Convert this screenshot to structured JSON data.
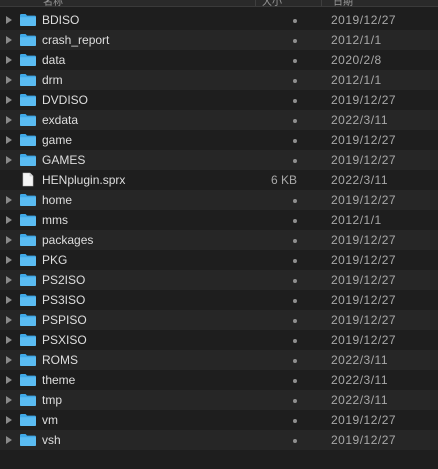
{
  "header": {
    "name": "名称",
    "size": "大小",
    "date": "日期"
  },
  "rows": [
    {
      "name": "BDISO",
      "type": "folder",
      "size": "",
      "date": "2019/12/27"
    },
    {
      "name": "crash_report",
      "type": "folder",
      "size": "",
      "date": "2012/1/1"
    },
    {
      "name": "data",
      "type": "folder",
      "size": "",
      "date": "2020/2/8"
    },
    {
      "name": "drm",
      "type": "folder",
      "size": "",
      "date": "2012/1/1"
    },
    {
      "name": "DVDISO",
      "type": "folder",
      "size": "",
      "date": "2019/12/27"
    },
    {
      "name": "exdata",
      "type": "folder",
      "size": "",
      "date": "2022/3/11"
    },
    {
      "name": "game",
      "type": "folder",
      "size": "",
      "date": "2019/12/27"
    },
    {
      "name": "GAMES",
      "type": "folder",
      "size": "",
      "date": "2019/12/27"
    },
    {
      "name": "HENplugin.sprx",
      "type": "file",
      "size": "6 KB",
      "date": "2022/3/11"
    },
    {
      "name": "home",
      "type": "folder",
      "size": "",
      "date": "2019/12/27"
    },
    {
      "name": "mms",
      "type": "folder",
      "size": "",
      "date": "2012/1/1"
    },
    {
      "name": "packages",
      "type": "folder",
      "size": "",
      "date": "2019/12/27"
    },
    {
      "name": "PKG",
      "type": "folder",
      "size": "",
      "date": "2019/12/27"
    },
    {
      "name": "PS2ISO",
      "type": "folder",
      "size": "",
      "date": "2019/12/27"
    },
    {
      "name": "PS3ISO",
      "type": "folder",
      "size": "",
      "date": "2019/12/27"
    },
    {
      "name": "PSPISO",
      "type": "folder",
      "size": "",
      "date": "2019/12/27"
    },
    {
      "name": "PSXISO",
      "type": "folder",
      "size": "",
      "date": "2019/12/27"
    },
    {
      "name": "ROMS",
      "type": "folder",
      "size": "",
      "date": "2022/3/11"
    },
    {
      "name": "theme",
      "type": "folder",
      "size": "",
      "date": "2022/3/11"
    },
    {
      "name": "tmp",
      "type": "folder",
      "size": "",
      "date": "2022/3/11"
    },
    {
      "name": "vm",
      "type": "folder",
      "size": "",
      "date": "2019/12/27"
    },
    {
      "name": "vsh",
      "type": "folder",
      "size": "",
      "date": "2019/12/27"
    }
  ],
  "icons": {
    "folder": "folder-icon",
    "file": "document-icon",
    "disclosure": "disclosure-triangle-icon"
  },
  "colors": {
    "folder": "#3fa9e8",
    "folder_tab": "#5bbcf2",
    "background": "#1e1e1e",
    "alt_row": "#262626"
  }
}
